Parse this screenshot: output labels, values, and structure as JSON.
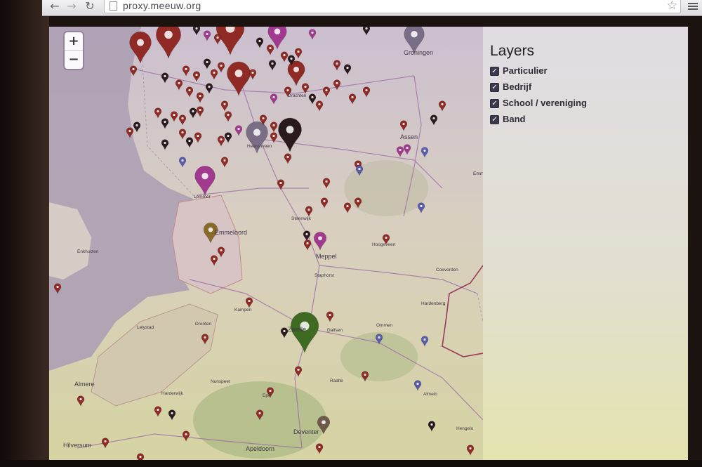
{
  "browser": {
    "url": "proxy.meeuw.org",
    "back_icon": "back-arrow-icon",
    "forward_icon": "forward-arrow-icon",
    "reload_icon": "reload-icon",
    "bookmark_icon": "star-icon",
    "menu_icon": "hamburger-menu-icon"
  },
  "map": {
    "zoom_in": "+",
    "zoom_out": "−",
    "place_labels": [
      "Groningen",
      "Assen",
      "Emmeloord",
      "Meppel",
      "Zwolle",
      "Almere",
      "Deventer",
      "Apeldoorn",
      "Hilversum",
      "Enkhuizen",
      "Lemmer",
      "Heerenveen",
      "Drachten",
      "Hoogeveen",
      "Kampen",
      "Dronten",
      "Lelystad",
      "Hardenberg",
      "Ommen",
      "Almelo",
      "Hengelo",
      "Steenwijk",
      "Raalte",
      "Harderwijk",
      "Staphorst",
      "Dalfsen",
      "Nunspeet",
      "Epe",
      "Emmen",
      "Coevorden"
    ],
    "pin_colors": {
      "particulier": "#8f2a24",
      "bedrijf": "#2b1a1d",
      "school": "#a13a8e",
      "band": "#5a5cab",
      "highlight": "#3e6a22"
    }
  },
  "layers": {
    "title": "Layers",
    "items": [
      {
        "label": "Particulier",
        "checked": true
      },
      {
        "label": "Bedrijf",
        "checked": true
      },
      {
        "label": "School / vereniging",
        "checked": true
      },
      {
        "label": "Band",
        "checked": true
      }
    ]
  }
}
